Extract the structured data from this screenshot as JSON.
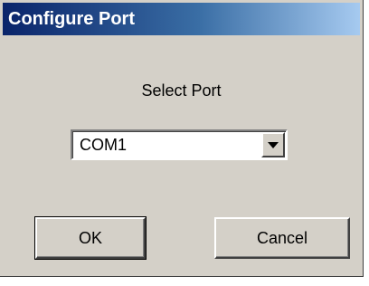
{
  "window": {
    "title": "Configure Port"
  },
  "prompt": {
    "label": "Select Port"
  },
  "port_select": {
    "value": "COM1"
  },
  "buttons": {
    "ok_label": "OK",
    "cancel_label": "Cancel"
  }
}
